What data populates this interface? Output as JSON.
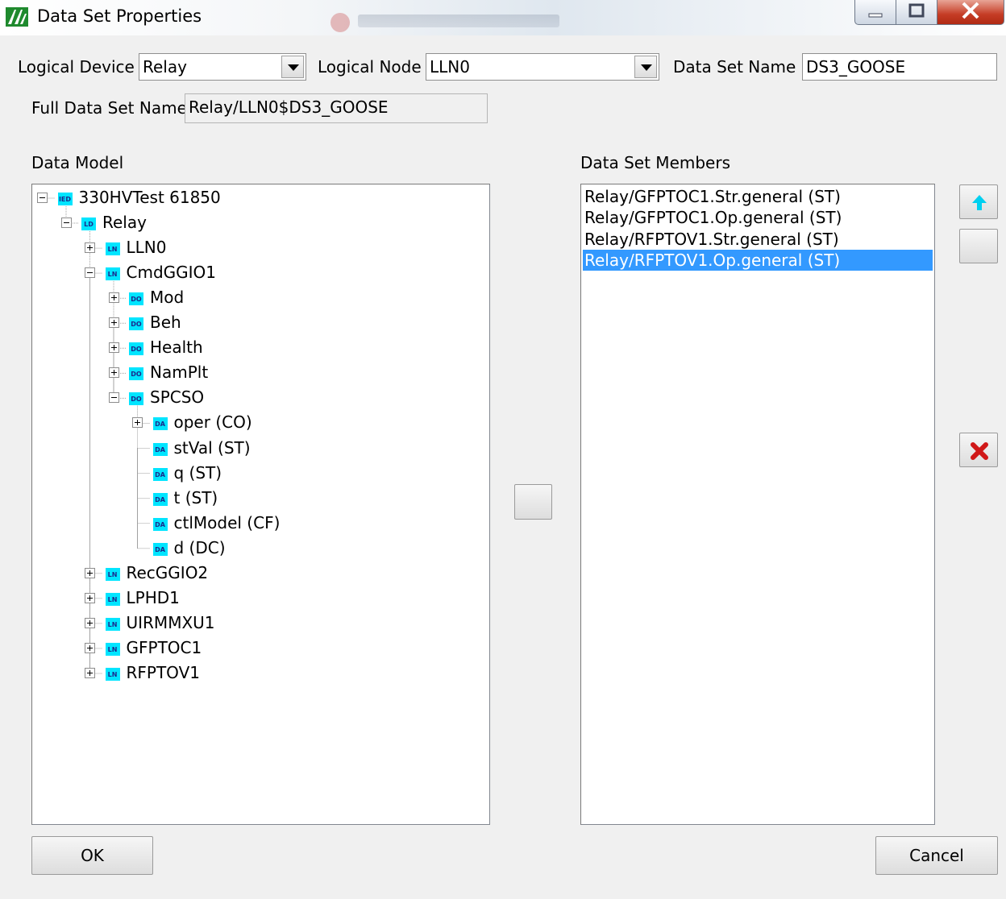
{
  "window": {
    "title": "Data Set Properties",
    "controls": [
      "minimize-icon",
      "maximize-icon",
      "close-icon"
    ]
  },
  "header": {
    "logical_device_label": "Logical Device",
    "logical_device_value": "Relay",
    "logical_node_label": "Logical Node",
    "logical_node_value": "LLN0",
    "data_set_name_label": "Data Set Name",
    "data_set_name_value": "DS3_GOOSE",
    "full_name_label": "Full Data Set Name",
    "full_name_value": "Relay/LLN0$DS3_GOOSE"
  },
  "data_model": {
    "label": "Data Model",
    "nodes": [
      {
        "badge": "IED",
        "label": "330HVTest 61850",
        "expander": "minus"
      },
      {
        "badge": "LD",
        "label": "Relay",
        "expander": "minus"
      },
      {
        "badge": "LN",
        "label": "LLN0",
        "expander": "plus"
      },
      {
        "badge": "LN",
        "label": "CmdGGIO1",
        "expander": "minus"
      },
      {
        "badge": "DO",
        "label": "Mod",
        "expander": "plus"
      },
      {
        "badge": "DO",
        "label": "Beh",
        "expander": "plus"
      },
      {
        "badge": "DO",
        "label": "Health",
        "expander": "plus"
      },
      {
        "badge": "DO",
        "label": "NamPlt",
        "expander": "plus"
      },
      {
        "badge": "DO",
        "label": "SPCSO",
        "expander": "minus"
      },
      {
        "badge": "DA",
        "label": "oper (CO)",
        "expander": "plus"
      },
      {
        "badge": "DA",
        "label": "stVal (ST)",
        "expander": "none"
      },
      {
        "badge": "DA",
        "label": "q (ST)",
        "expander": "none"
      },
      {
        "badge": "DA",
        "label": "t (ST)",
        "expander": "none"
      },
      {
        "badge": "DA",
        "label": "ctlModel (CF)",
        "expander": "none"
      },
      {
        "badge": "DA",
        "label": "d (DC)",
        "expander": "none"
      },
      {
        "badge": "LN",
        "label": "RecGGIO2",
        "expander": "plus"
      },
      {
        "badge": "LN",
        "label": "LPHD1",
        "expander": "plus"
      },
      {
        "badge": "LN",
        "label": "UIRMMXU1",
        "expander": "plus"
      },
      {
        "badge": "LN",
        "label": "GFPTOC1",
        "expander": "plus"
      },
      {
        "badge": "LN",
        "label": "RFPTOV1",
        "expander": "plus"
      }
    ]
  },
  "members": {
    "label": "Data Set Members",
    "items": [
      "Relay/GFPTOC1.Str.general (ST)",
      "Relay/GFPTOC1.Op.general (ST)",
      "Relay/RFPTOV1.Str.general (ST)",
      "Relay/RFPTOV1.Op.general (ST)"
    ],
    "selected": "Relay/RFPTOV1.Op.general (ST)"
  },
  "side_buttons": {
    "up_icon": "arrow-up-icon",
    "down_icon": "",
    "delete_icon": "delete-x-icon",
    "add_icon": ""
  },
  "footer": {
    "ok_label": "OK",
    "cancel_label": "Cancel"
  },
  "colors": {
    "badge": "#00e5ff",
    "selection": "#3399ff",
    "up_arrow": "#00d0f0",
    "delete": "#d01818"
  }
}
